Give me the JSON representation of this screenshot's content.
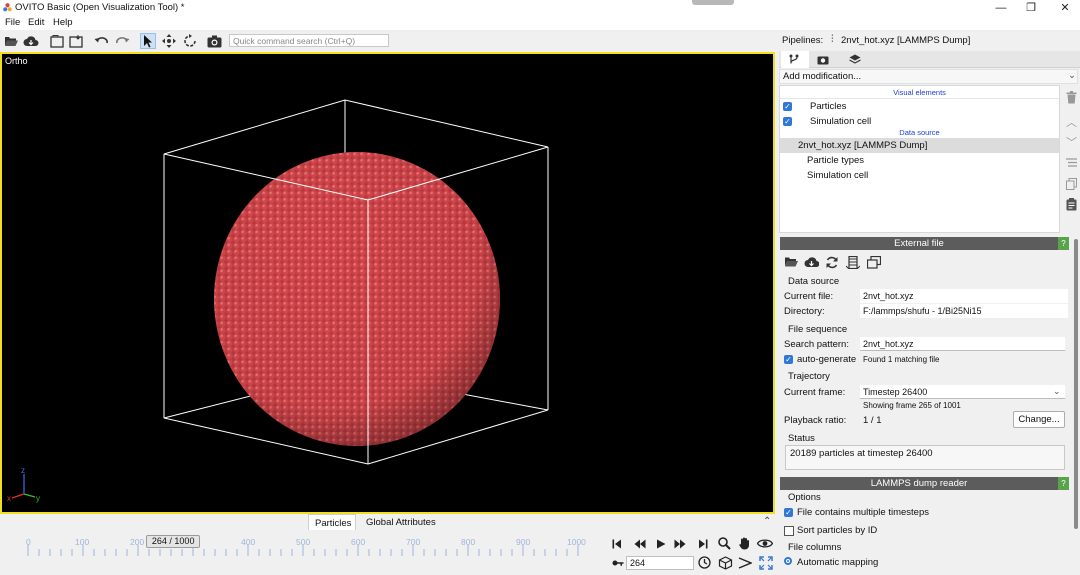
{
  "window": {
    "title": "OVITO Basic (Open Visualization Tool) *",
    "minimize": "—",
    "maximize": "❐",
    "close": "✕"
  },
  "menu": [
    "File",
    "Edit",
    "Help"
  ],
  "toolbar": {
    "search_placeholder": "Quick command search (Ctrl+Q)"
  },
  "viewport": {
    "caption": "Ortho",
    "axes": {
      "x": "x",
      "y": "y",
      "z": "z"
    },
    "sphere_color": "#d94a4f",
    "border_color": "#f0e020"
  },
  "viewport_tabs": [
    "Particles",
    "Global Attributes"
  ],
  "timeline": {
    "ticks": [
      "0",
      "100",
      "200",
      "300",
      "400",
      "500",
      "600",
      "700",
      "800",
      "900",
      "1000"
    ],
    "current_label": "264 / 1000",
    "frame_value": "264",
    "current_frame": 264,
    "max_frame": 1000
  },
  "pipeline": {
    "label": "Pipelines:",
    "selected": "2nvt_hot.xyz [LAMMPS Dump]",
    "add_modification": "Add modification...",
    "visual_elements_header": "Visual elements",
    "visual_elements": [
      "Particles",
      "Simulation cell"
    ],
    "data_source_header": "Data source",
    "source_item": "2nvt_hot.xyz [LAMMPS Dump]",
    "source_children": [
      "Particle types",
      "Simulation cell"
    ]
  },
  "external_file": {
    "header": "External file",
    "help": "?",
    "data_source_title": "Data source",
    "current_file_label": "Current file:",
    "current_file": "2nvt_hot.xyz",
    "directory_label": "Directory:",
    "directory": "F:/lammps/shufu - 1/Bi25Ni15",
    "file_sequence_title": "File sequence",
    "search_pattern_label": "Search pattern:",
    "search_pattern": "2nvt_hot.xyz",
    "auto_generate": "auto-generate",
    "found": "Found 1 matching file",
    "trajectory_title": "Trajectory",
    "current_frame_label": "Current frame:",
    "current_frame": "Timestep 26400",
    "showing": "Showing frame 265 of 1001",
    "playback_label": "Playback ratio:",
    "playback_value": "1 / 1",
    "change_button": "Change...",
    "status_title": "Status",
    "status_text": "20189 particles at timestep 26400"
  },
  "lammps_reader": {
    "header": "LAMMPS dump reader",
    "help": "?",
    "options_title": "Options",
    "multiple_timesteps": "File contains multiple timesteps",
    "sort_by_id": "Sort particles by ID",
    "file_columns_title": "File columns",
    "automatic_mapping": "Automatic mapping"
  }
}
